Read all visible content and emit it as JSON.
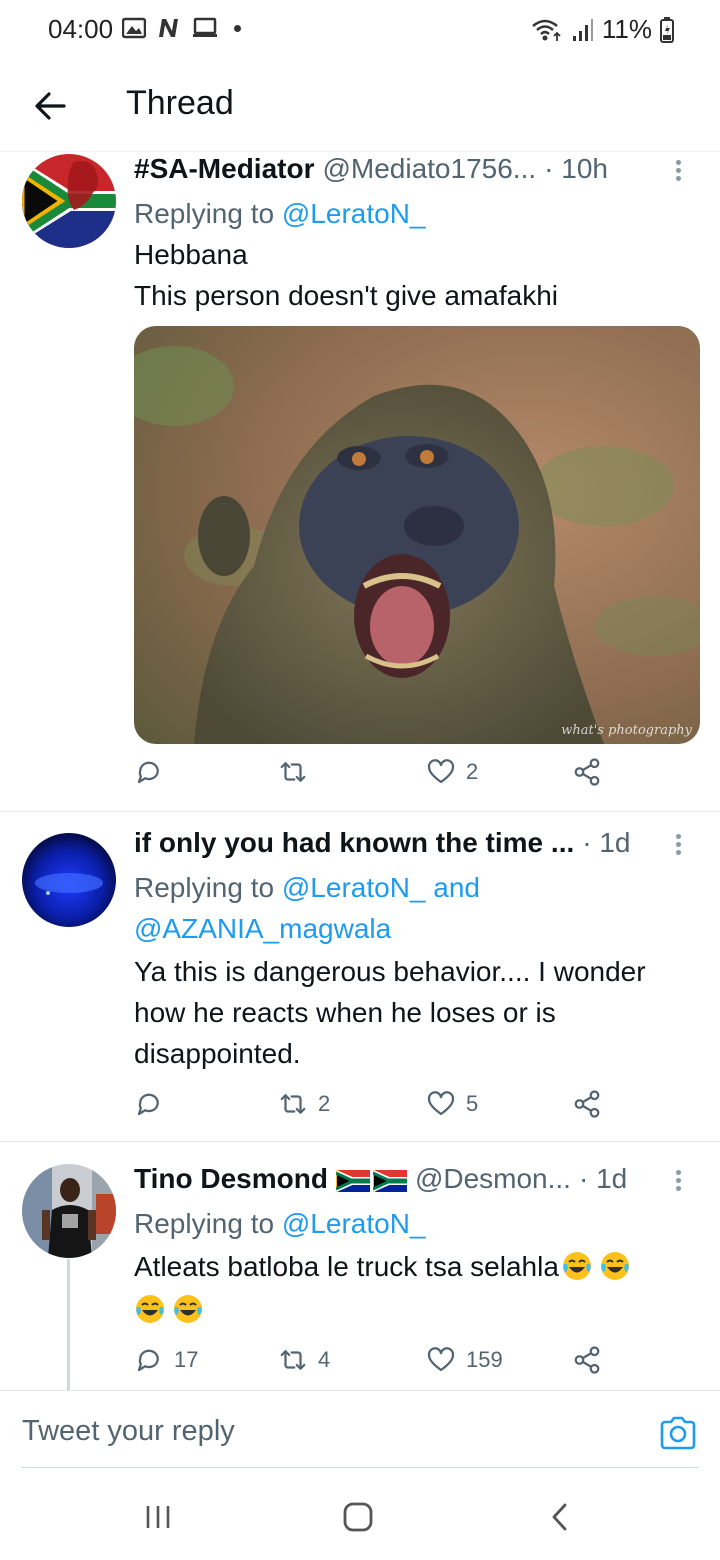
{
  "status_bar": {
    "time": "04:00",
    "battery": "11%",
    "icons": [
      "gallery-icon",
      "n-icon",
      "screen-icon",
      "dot-icon",
      "wifi-icon",
      "signal-icon",
      "battery-icon"
    ]
  },
  "header": {
    "title": "Thread",
    "back_icon": "arrow-left-icon"
  },
  "tweets": [
    {
      "name": "#SA-Mediator",
      "handle": "@Mediato1756...",
      "time": "· 10h",
      "replying_prefix": "Replying to",
      "replying_to": "@LeratoN_",
      "text_lines": [
        "Hebbana",
        "This person doesn't give amafakhi"
      ],
      "media_watermark": "what's photography",
      "counts": {
        "reply": "",
        "retweet": "",
        "like": "2"
      }
    },
    {
      "name": "if only you had known the time ...",
      "handle": "",
      "time": "· 1d",
      "replying_prefix": "Replying to",
      "replying_to": "@LeratoN_",
      "replying_and": "and",
      "replying_to_2": "@AZANIA_magwala",
      "text_lines": [
        "Ya this is dangerous behavior.... I wonder",
        "how he reacts when he loses or is",
        "disappointed."
      ],
      "counts": {
        "reply": "",
        "retweet": "2",
        "like": "5"
      }
    },
    {
      "name": "Tino Desmond",
      "handle": "@Desmon...",
      "time": "· 1d",
      "replying_prefix": "Replying to",
      "replying_to": "@LeratoN_",
      "text_lines": [
        "Atleats batloba le truck tsa selahla"
      ],
      "counts": {
        "reply": "17",
        "retweet": "4",
        "like": "159"
      }
    }
  ],
  "reply_bar": {
    "placeholder": "Tweet your reply",
    "camera_icon": "camera-icon"
  },
  "nav_bar": {
    "buttons": [
      "recents-icon",
      "home-icon",
      "back-icon"
    ]
  },
  "colors": {
    "link": "#1d9bf0",
    "secondary_text": "#536471",
    "primary_text": "#0f1419",
    "divider": "#e4e8ea"
  }
}
